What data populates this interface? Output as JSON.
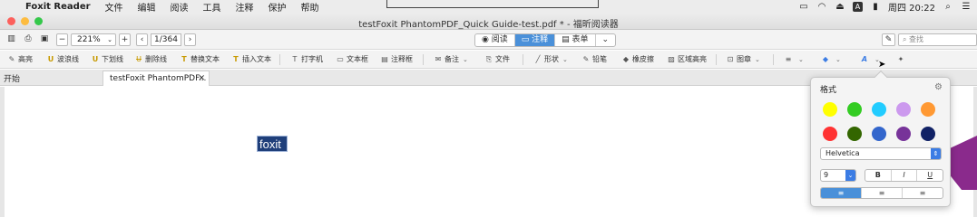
{
  "menubar": {
    "app_name": "Foxit Reader",
    "items": [
      "文件",
      "编辑",
      "阅读",
      "工具",
      "注释",
      "保护",
      "帮助"
    ],
    "clock": "周四 20:22",
    "input_badge": "A"
  },
  "window": {
    "title": "testFoxit PhantomPDF_Quick Guide-test.pdf * - 福昕阅读器"
  },
  "toolbar": {
    "zoom_value": "221%",
    "page_value": "1/364",
    "modes": [
      {
        "label": "阅读",
        "icon": "eye-icon"
      },
      {
        "label": "注释",
        "icon": "comment-icon"
      },
      {
        "label": "表单",
        "icon": "form-icon"
      }
    ],
    "active_mode": "注释",
    "search_placeholder": "查找"
  },
  "annot_tools": [
    {
      "label": "高亮",
      "icon": "highlight-icon"
    },
    {
      "label": "波浪线",
      "icon": "squiggly-icon"
    },
    {
      "label": "下划线",
      "icon": "underline-icon"
    },
    {
      "label": "删除线",
      "icon": "strikeout-icon"
    },
    {
      "label": "替换文本",
      "icon": "replace-text-icon"
    },
    {
      "label": "插入文本",
      "icon": "insert-text-icon"
    },
    {
      "label": "打字机",
      "icon": "typewriter-icon"
    },
    {
      "label": "文本框",
      "icon": "textbox-icon"
    },
    {
      "label": "注释框",
      "icon": "callout-icon"
    },
    {
      "label": "备注",
      "icon": "note-icon"
    },
    {
      "label": "文件",
      "icon": "file-attach-icon"
    },
    {
      "label": "形状",
      "icon": "shape-icon"
    },
    {
      "label": "铅笔",
      "icon": "pencil-icon"
    },
    {
      "label": "橡皮擦",
      "icon": "eraser-icon"
    },
    {
      "label": "区域高亮",
      "icon": "area-highlight-icon"
    },
    {
      "label": "图章",
      "icon": "stamp-icon"
    }
  ],
  "tabs": {
    "home": "开始",
    "document": "testFoxit PhantomPDF..."
  },
  "document": {
    "selected_text": "foxit"
  },
  "format_popover": {
    "title": "格式",
    "colors": [
      "#ffff00",
      "#33cc22",
      "#22ccff",
      "#cc99ee",
      "#ff9933",
      "#ff3333",
      "#336600",
      "#3366cc",
      "#773399",
      "#112266"
    ],
    "font": "Helvetica",
    "size": "9",
    "styles": [
      "B",
      "I",
      "U"
    ],
    "align": [
      "left",
      "center",
      "right"
    ],
    "active_align": "left"
  }
}
